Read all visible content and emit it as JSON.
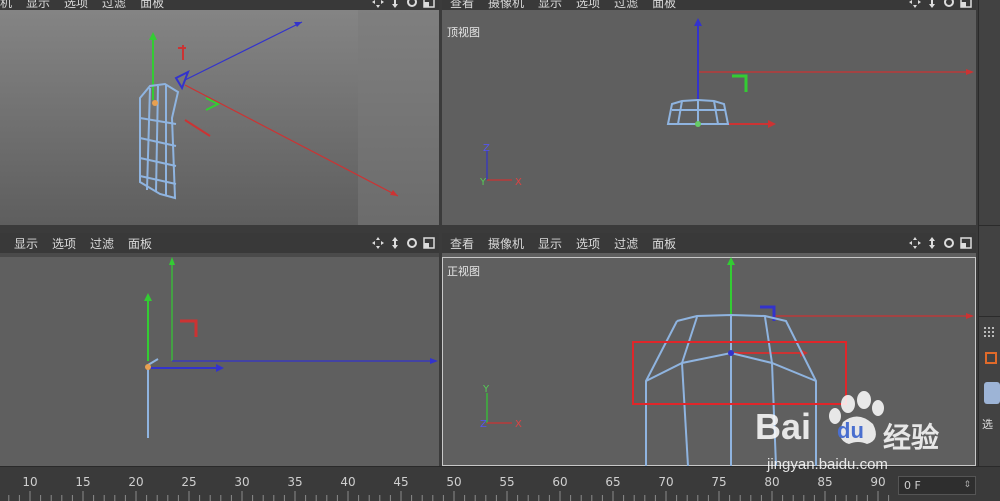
{
  "viewports": {
    "top_left": {
      "menu": [
        "机",
        "显示",
        "选项",
        "过滤",
        "面板"
      ]
    },
    "top_right": {
      "menu": [
        "查看",
        "摄像机",
        "显示",
        "选项",
        "过滤",
        "面板"
      ],
      "label": "顶视图",
      "axis": {
        "up": "Z",
        "origin": "Y",
        "right": "X"
      }
    },
    "bottom_left": {
      "menu": [
        "显示",
        "选项",
        "过滤",
        "面板"
      ]
    },
    "bottom_right": {
      "menu": [
        "查看",
        "摄像机",
        "显示",
        "选项",
        "过滤",
        "面板"
      ],
      "label": "正视图",
      "axis": {
        "up": "Y",
        "origin": "Z",
        "right": "X"
      }
    }
  },
  "timeline": {
    "ticks": [
      "10",
      "15",
      "20",
      "25",
      "30",
      "35",
      "40",
      "45",
      "50",
      "55",
      "60",
      "65",
      "70",
      "75",
      "80",
      "85",
      "90"
    ],
    "frame": "0 F"
  },
  "right_panel": {
    "label": "选"
  },
  "watermark": {
    "brand_left": "Bai",
    "brand_right": "du",
    "suffix": "经验",
    "url": "jingyan.baidu.com"
  },
  "colors": {
    "axis_x": "#d0393a",
    "axis_y": "#3fbf3f",
    "axis_z": "#3d3ddb",
    "mesh": "#8fb4e0",
    "highlight": "#e0262a"
  }
}
